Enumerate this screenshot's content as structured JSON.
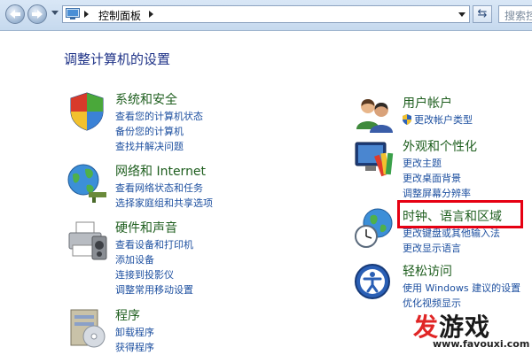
{
  "address": {
    "path_segment": "控制面板",
    "search_placeholder": "搜索控"
  },
  "heading": "调整计算机的设置",
  "left_categories": [
    {
      "title": "系统和安全",
      "links": [
        "查看您的计算机状态",
        "备份您的计算机",
        "查找并解决问题"
      ]
    },
    {
      "title": "网络和 Internet",
      "links": [
        "查看网络状态和任务",
        "选择家庭组和共享选项"
      ]
    },
    {
      "title": "硬件和声音",
      "links": [
        "查看设备和打印机",
        "添加设备",
        "连接到投影仪",
        "调整常用移动设置"
      ]
    },
    {
      "title": "程序",
      "links": [
        "卸载程序",
        "获得程序"
      ]
    }
  ],
  "right_categories": [
    {
      "title": "用户帐户",
      "links": [
        "更改帐户类型"
      ]
    },
    {
      "title": "外观和个性化",
      "links": [
        "更改主题",
        "更改桌面背景",
        "调整屏幕分辨率"
      ]
    },
    {
      "title": "时钟、语言和区域",
      "links": [
        "更改键盘或其他输入法",
        "更改显示语言"
      ]
    },
    {
      "title": "轻松访问",
      "links": [
        "使用 Windows 建议的设置",
        "优化视频显示"
      ]
    }
  ],
  "watermark": {
    "text_red": "发",
    "text_black": "游戏",
    "url": "www.favouxi.com"
  },
  "colors": {
    "category_title": "#1e5e1e",
    "link": "#1e50a0",
    "highlight_border": "#e60012"
  },
  "icons": {
    "back": "back-arrow-icon",
    "forward": "forward-arrow-icon",
    "refresh": "refresh-icon",
    "control_panel": "control-panel-icon",
    "uac_shield": "uac-shield-icon"
  }
}
